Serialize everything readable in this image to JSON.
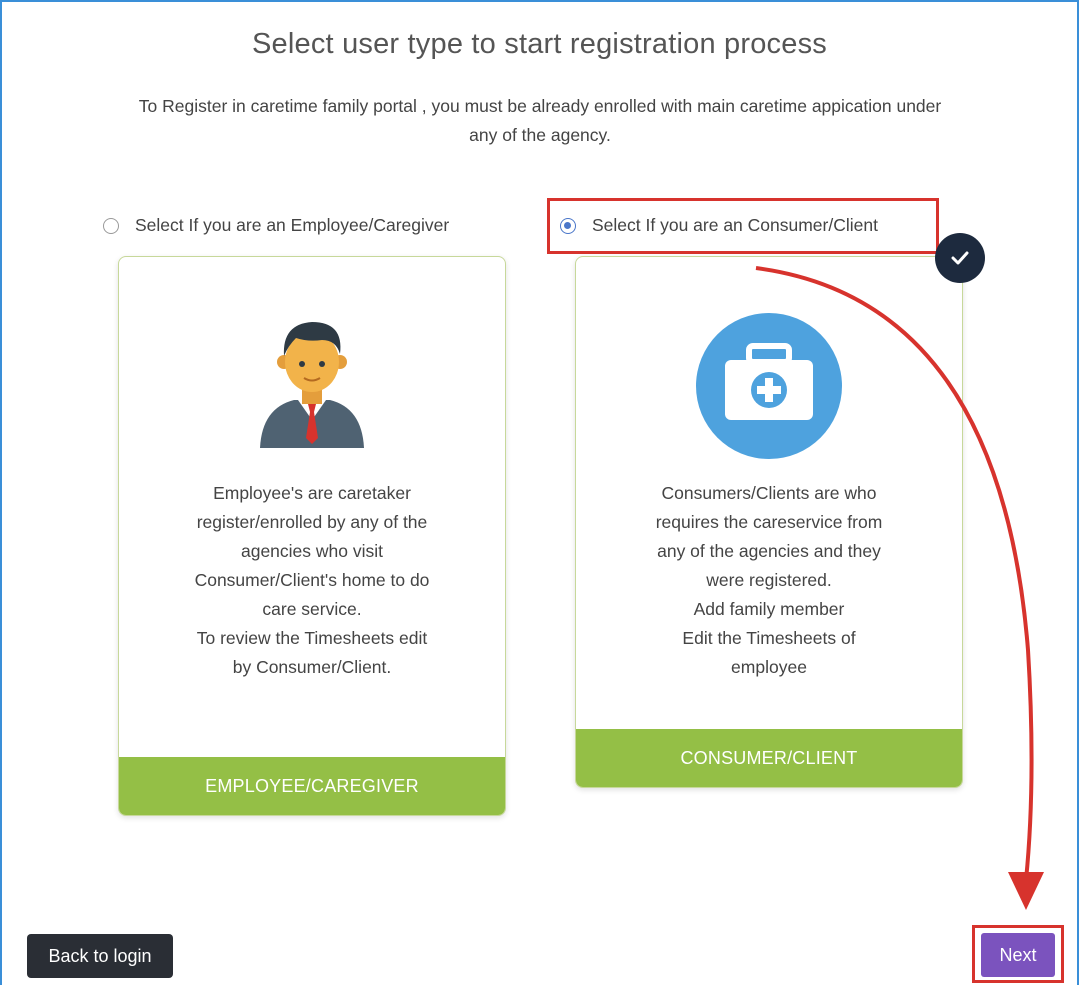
{
  "page": {
    "title": "Select user type to start registration process",
    "subtitle": "To Register in caretime family portal , you must be already enrolled with main caretime appication under any of the agency."
  },
  "options": {
    "employee": {
      "radio_label": "Select If you are an Employee/Caregiver",
      "selected": false,
      "description": "Employee's are caretaker\nregister/enrolled by any of the\nagencies who visit\nConsumer/Client's home to do\ncare service.\nTo review the Timesheets edit\nby Consumer/Client.",
      "footer_label": "EMPLOYEE/CAREGIVER",
      "icon": "employee-avatar-icon"
    },
    "consumer": {
      "radio_label": "Select If you are an Consumer/Client",
      "selected": true,
      "description": "Consumers/Clients are who\nrequires the careservice from\nany of the agencies and they\nwere registered.\nAdd family member\nEdit the Timesheets of\nemployee",
      "footer_label": "CONSUMER/CLIENT",
      "icon": "medical-kit-icon"
    }
  },
  "buttons": {
    "back": "Back to login",
    "next": "Next"
  },
  "colors": {
    "accent_green": "#94bf46",
    "next_purple": "#7b53be",
    "highlight_red": "#d7332d",
    "badge_navy": "#1d2a3e",
    "radio_blue": "#4a76c9"
  }
}
